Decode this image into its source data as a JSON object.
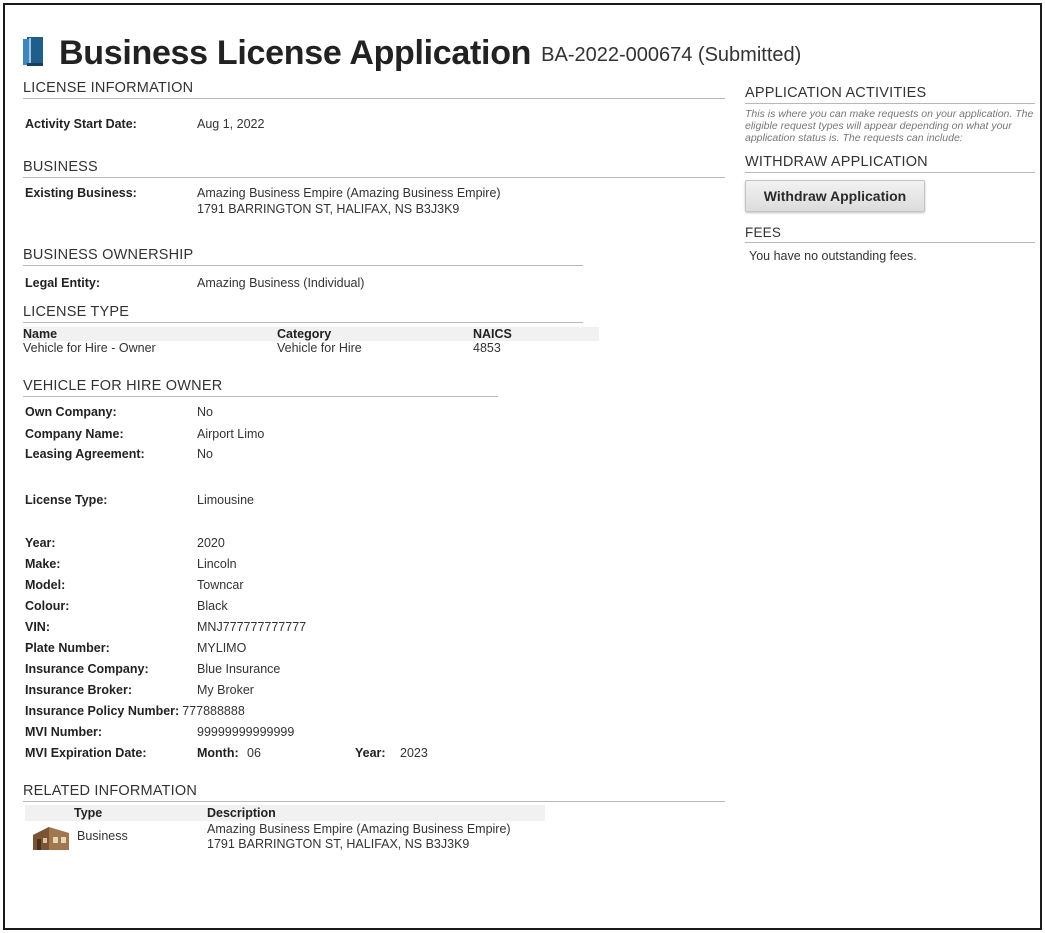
{
  "header": {
    "title": "Business License Application",
    "subtitle": "BA-2022-000674 (Submitted)",
    "icon": "book-icon"
  },
  "license_information": {
    "heading": "LICENSE INFORMATION",
    "activity_start_label": "Activity Start Date:",
    "activity_start_value": "Aug 1, 2022"
  },
  "business": {
    "heading": "BUSINESS",
    "existing_label": "Existing Business:",
    "existing_name": "Amazing Business Empire (Amazing Business Empire)",
    "existing_address": "1791 BARRINGTON ST, HALIFAX, NS B3J3K9"
  },
  "ownership": {
    "heading": "BUSINESS OWNERSHIP",
    "legal_entity_label": "Legal Entity:",
    "legal_entity_value": "Amazing Business (Individual)"
  },
  "license_type": {
    "heading": "LICENSE TYPE",
    "columns": [
      "Name",
      "Category",
      "NAICS"
    ],
    "rows": [
      [
        "Vehicle for Hire - Owner",
        "Vehicle for Hire",
        "4853"
      ]
    ]
  },
  "vehicle": {
    "heading": "VEHICLE FOR HIRE OWNER",
    "own_company": {
      "label": "Own Company:",
      "value": "No"
    },
    "company_name": {
      "label": "Company Name:",
      "value": "Airport Limo"
    },
    "leasing_agreement": {
      "label": "Leasing Agreement:",
      "value": "No"
    },
    "license_type": {
      "label": "License Type:",
      "value": "Limousine"
    },
    "year": {
      "label": "Year:",
      "value": "2020"
    },
    "make": {
      "label": "Make:",
      "value": "Lincoln"
    },
    "model": {
      "label": "Model:",
      "value": "Towncar"
    },
    "colour": {
      "label": "Colour:",
      "value": "Black"
    },
    "vin": {
      "label": "VIN:",
      "value": "MNJ777777777777"
    },
    "plate": {
      "label": "Plate Number:",
      "value": "MYLIMO"
    },
    "insurance_company": {
      "label": "Insurance Company:",
      "value": "Blue Insurance"
    },
    "insurance_broker": {
      "label": "Insurance Broker:",
      "value": "My Broker"
    },
    "policy_number": {
      "label": "Insurance Policy Number:",
      "value": "777888888"
    },
    "mvi_number": {
      "label": "MVI Number:",
      "value": "99999999999999"
    },
    "mvi_expiration": {
      "label": "MVI Expiration Date:",
      "month_label": "Month:",
      "month_value": "06",
      "year_label": "Year:",
      "year_value": "2023"
    }
  },
  "related": {
    "heading": "RELATED INFORMATION",
    "columns": [
      "Type",
      "Description"
    ],
    "rows": [
      {
        "type": "Business",
        "icon": "building-icon",
        "desc_line1": "Amazing Business Empire (Amazing Business Empire)",
        "desc_line2": "1791 BARRINGTON ST, HALIFAX, NS B3J3K9"
      }
    ]
  },
  "activities": {
    "heading": "APPLICATION ACTIVITIES",
    "note": "This is where you can make requests on your application. The eligible request types will appear depending on what your application status is. The requests can include:",
    "withdraw_heading": "WITHDRAW APPLICATION",
    "withdraw_button": "Withdraw Application",
    "fees_heading": "FEES",
    "fees_text": "You have no outstanding fees."
  }
}
